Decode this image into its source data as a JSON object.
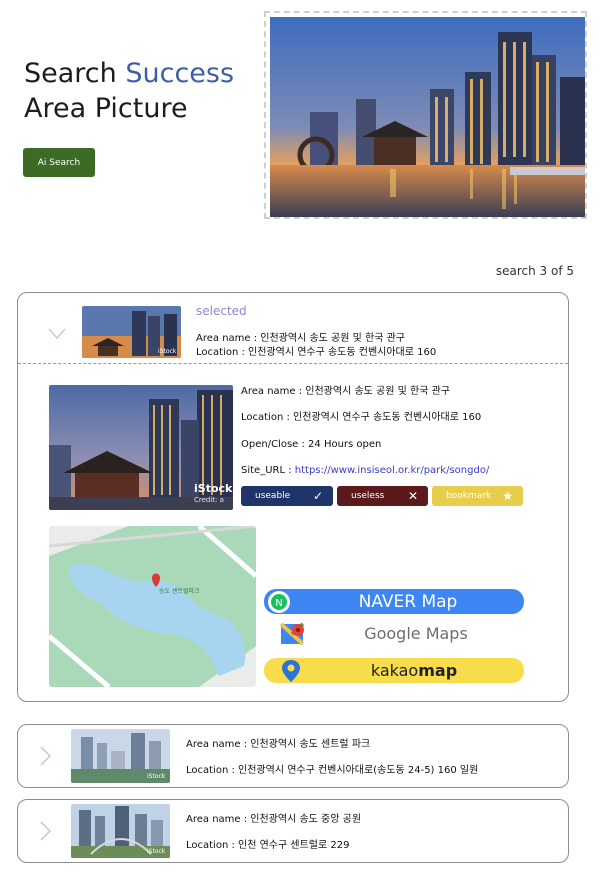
{
  "hero": {
    "title_line1_word1": "Search",
    "title_line1_word2": "Success",
    "title_line2": "Area Picture",
    "ai_button": "Ai Search"
  },
  "search_count": "search 3 of 5",
  "selected_card": {
    "selected_label": "selected",
    "area_name": "Area name : 인천광역시 송도 공원 및 한국 관구",
    "location": "Location : 인천광역시 연수구 송도동 컨벤시아대로 160",
    "detail": {
      "area_name": "Area name : 인천광역시 송도 공원 및 한국 관구",
      "location": "Location : 인천광역시 연수구 송도동 컨벤시아대로 160",
      "open_close": "Open/Close : 24 Hours open",
      "site_label": "Site_URL : ",
      "site_url": "https://www.insiseol.or.kr/park/songdo/",
      "watermark": "iStock",
      "credit": "Credit: a"
    },
    "buttons": {
      "useable": "useable",
      "useless": "useless",
      "bookmark": "bookmark"
    },
    "map_labels": {
      "place": "송도 센트럴파크"
    },
    "map_services": {
      "naver": "NAVER Map",
      "google": "Google Maps",
      "kakao_regular": "kakao",
      "kakao_bold": "map"
    }
  },
  "results": [
    {
      "area_name": "Area name : 인천광역시 송도 센트럴 파크",
      "location": "Location : 인천광역시 연수구 컨벤시아대로(송도동 24-5) 160 일원"
    },
    {
      "area_name": "Area name : 인천광역시 송도 중앙 공원",
      "location": "Location : 인천 연수구 센트럴로 229"
    }
  ],
  "thumb_watermark": "iStock",
  "colors": {
    "accent": "#3d5fa8",
    "ai_button": "#3d6b25",
    "useable": "#1f3469",
    "useless": "#5a1a1b",
    "bookmark": "#e8cd4d",
    "naver": "#3d86f4",
    "kakao": "#f8dc4c"
  }
}
